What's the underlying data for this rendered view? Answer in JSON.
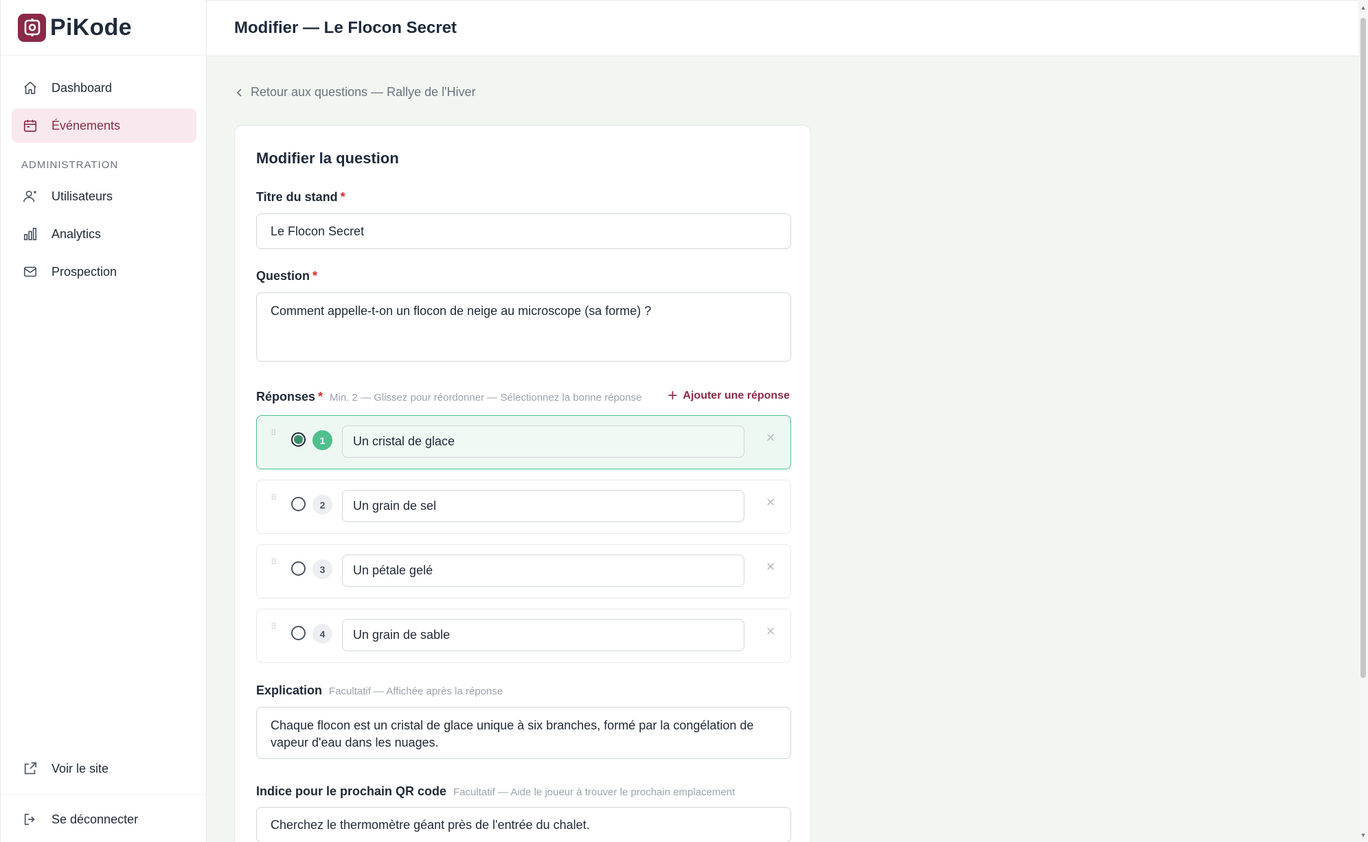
{
  "app": {
    "name": "PiKode",
    "brand_color": "#8b2947"
  },
  "sidebar": {
    "items": [
      {
        "label": "Dashboard",
        "icon": "home-icon",
        "active": false
      },
      {
        "label": "Événements",
        "icon": "calendar-icon",
        "active": true
      }
    ],
    "section_label": "ADMINISTRATION",
    "admin_items": [
      {
        "label": "Utilisateurs",
        "icon": "users-icon"
      },
      {
        "label": "Analytics",
        "icon": "bar-chart-icon"
      },
      {
        "label": "Prospection",
        "icon": "mail-icon"
      }
    ],
    "view_site": "Voir le site",
    "logout": "Se déconnecter"
  },
  "header": {
    "title": "Modifier — Le Flocon Secret"
  },
  "main": {
    "back_link": "Retour aux questions — Rallye de l'Hiver",
    "card_title": "Modifier la question",
    "stand_title": {
      "label": "Titre du stand",
      "required": "*",
      "value": "Le Flocon Secret"
    },
    "question": {
      "label": "Question",
      "required": "*",
      "value": "Comment appelle-t-on un flocon de neige au microscope (sa forme) ?"
    },
    "answers": {
      "label": "Réponses",
      "required": "*",
      "hint": "Min. 2 — Glissez pour réordonner — Sélectionnez la bonne réponse",
      "add_label": "Ajouter une réponse",
      "items": [
        {
          "number": "1",
          "text": "Un cristal de glace",
          "correct": true
        },
        {
          "number": "2",
          "text": "Un grain de sel",
          "correct": false
        },
        {
          "number": "3",
          "text": "Un pétale gelé",
          "correct": false
        },
        {
          "number": "4",
          "text": "Un grain de sable",
          "correct": false
        }
      ]
    },
    "explanation": {
      "label": "Explication",
      "hint": "Facultatif — Affichée après la réponse",
      "value": "Chaque flocon est un cristal de glace unique à six branches, formé par la congélation de vapeur d'eau dans les nuages."
    },
    "next_hint": {
      "label": "Indice pour le prochain QR code",
      "hint": "Facultatif — Aide le joueur à trouver le prochain emplacement",
      "value": "Cherchez le thermomètre géant près de l'entrée du chalet."
    }
  }
}
